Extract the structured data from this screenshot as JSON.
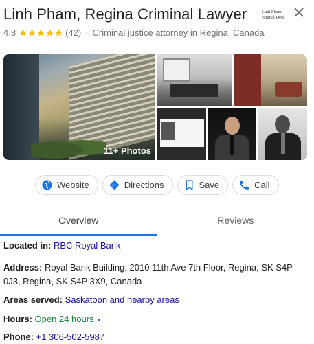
{
  "header": {
    "title": "Linh Pham, Regina Criminal Lawyer",
    "logo_text": [
      "Linh Pham,",
      "riminal Defe"
    ],
    "close_icon": "close-icon"
  },
  "rating": {
    "value": "4.8",
    "stars": 5,
    "reviews": "(42)",
    "separator": "·",
    "category": "Criminal justice attorney in Regina, Canada"
  },
  "photos": {
    "count_label": "11+ Photos"
  },
  "actions": [
    {
      "label": "Website",
      "icon": "globe-icon"
    },
    {
      "label": "Directions",
      "icon": "directions-icon"
    },
    {
      "label": "Save",
      "icon": "bookmark-icon"
    },
    {
      "label": "Call",
      "icon": "phone-icon"
    }
  ],
  "tabs": [
    {
      "label": "Overview",
      "active": true
    },
    {
      "label": "Reviews",
      "active": false
    }
  ],
  "details": {
    "located_in_label": "Located in:",
    "located_in_value": "RBC Royal Bank",
    "address_label": "Address:",
    "address_value": "Royal Bank Building, 2010 11th Ave 7th Floor, Regina, SK S4P 0J3, Regina, SK S4P 3X9, Canada",
    "areas_label": "Areas served:",
    "areas_value": "Saskatoon and nearby areas",
    "hours_label": "Hours:",
    "hours_value": "Open 24 hours",
    "phone_label": "Phone:",
    "phone_value": "+1 306-502-5987"
  },
  "colors": {
    "accent": "#1a73e8",
    "link": "#1a0dab",
    "open": "#188038",
    "star": "#fbbc04"
  }
}
